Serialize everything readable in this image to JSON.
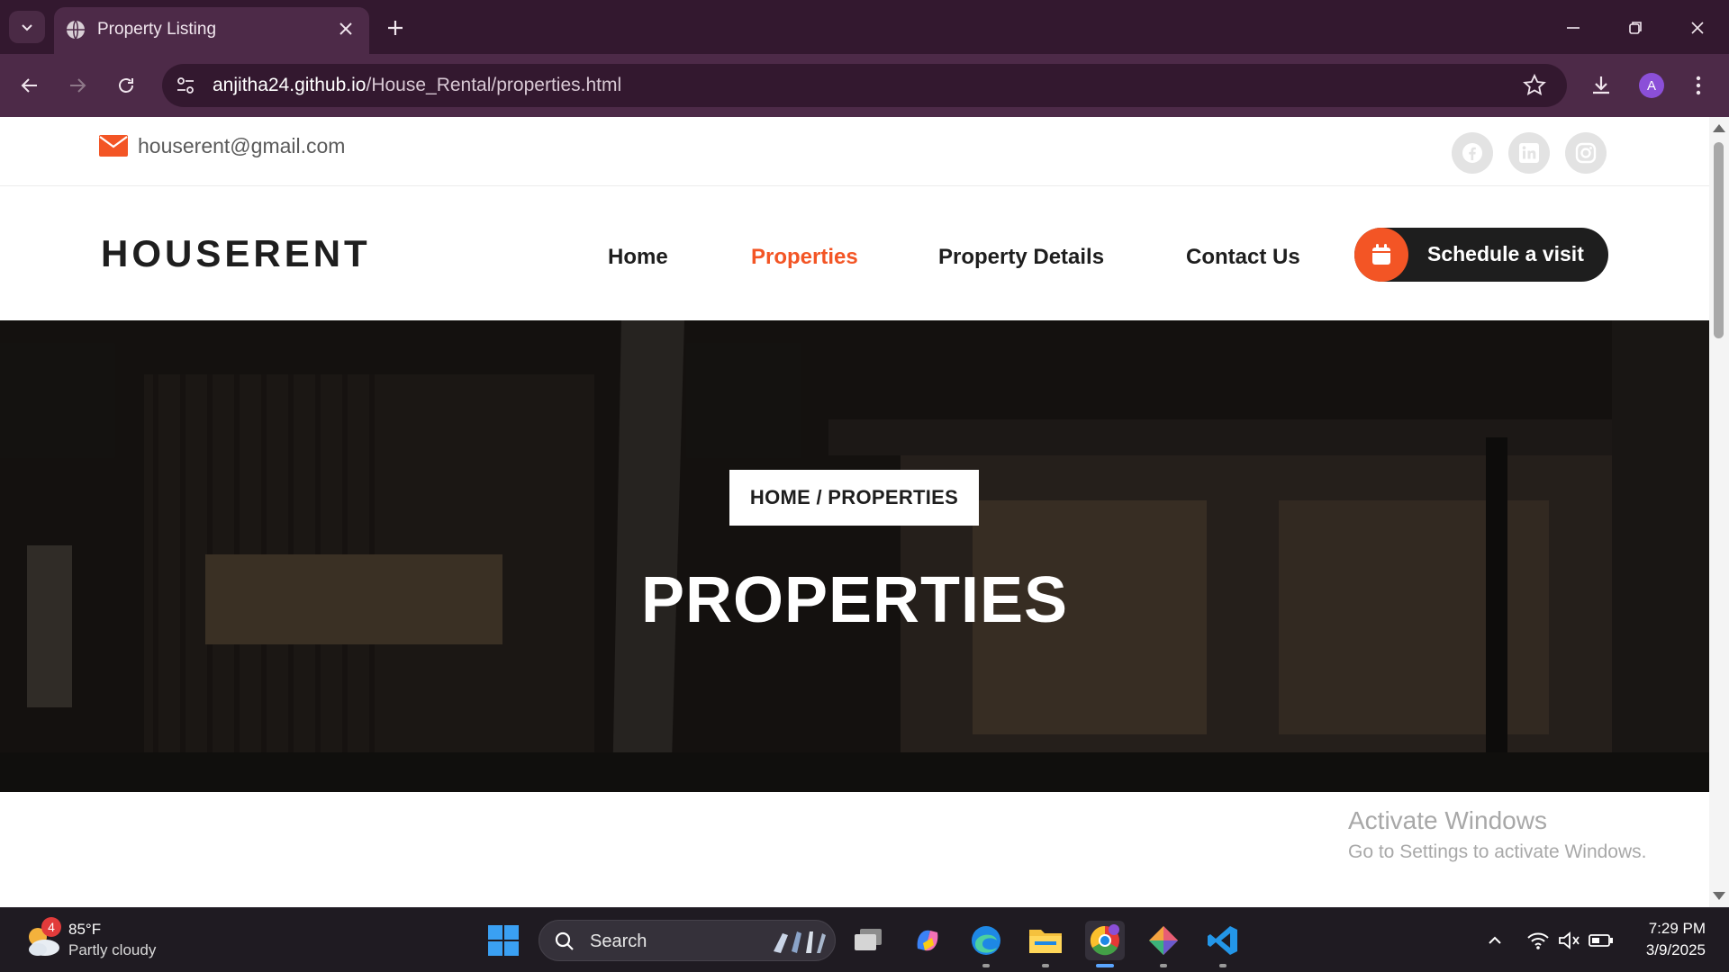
{
  "browser": {
    "tab_title": "Property Listing",
    "url_host": "anjitha24.github.io",
    "url_path": "/House_Rental/properties.html",
    "profile_initial": "A"
  },
  "page": {
    "email": "houserent@gmail.com",
    "logo": "HOUSERENT",
    "nav": [
      {
        "label": "Home"
      },
      {
        "label": "Properties",
        "active": true
      },
      {
        "label": "Property Details"
      },
      {
        "label": "Contact Us"
      }
    ],
    "cta_label": "Schedule a visit",
    "breadcrumb": "HOME / PROPERTIES",
    "hero_title": "PROPERTIES",
    "accent_color": "#f35525",
    "dark_color": "#1e1e1e"
  },
  "watermark": {
    "line1": "Activate Windows",
    "line2": "Go to Settings to activate Windows."
  },
  "taskbar": {
    "weather_badge": "4",
    "temperature": "85°F",
    "condition": "Partly cloudy",
    "search_label": "Search",
    "time": "7:29 PM",
    "date": "3/9/2025"
  }
}
